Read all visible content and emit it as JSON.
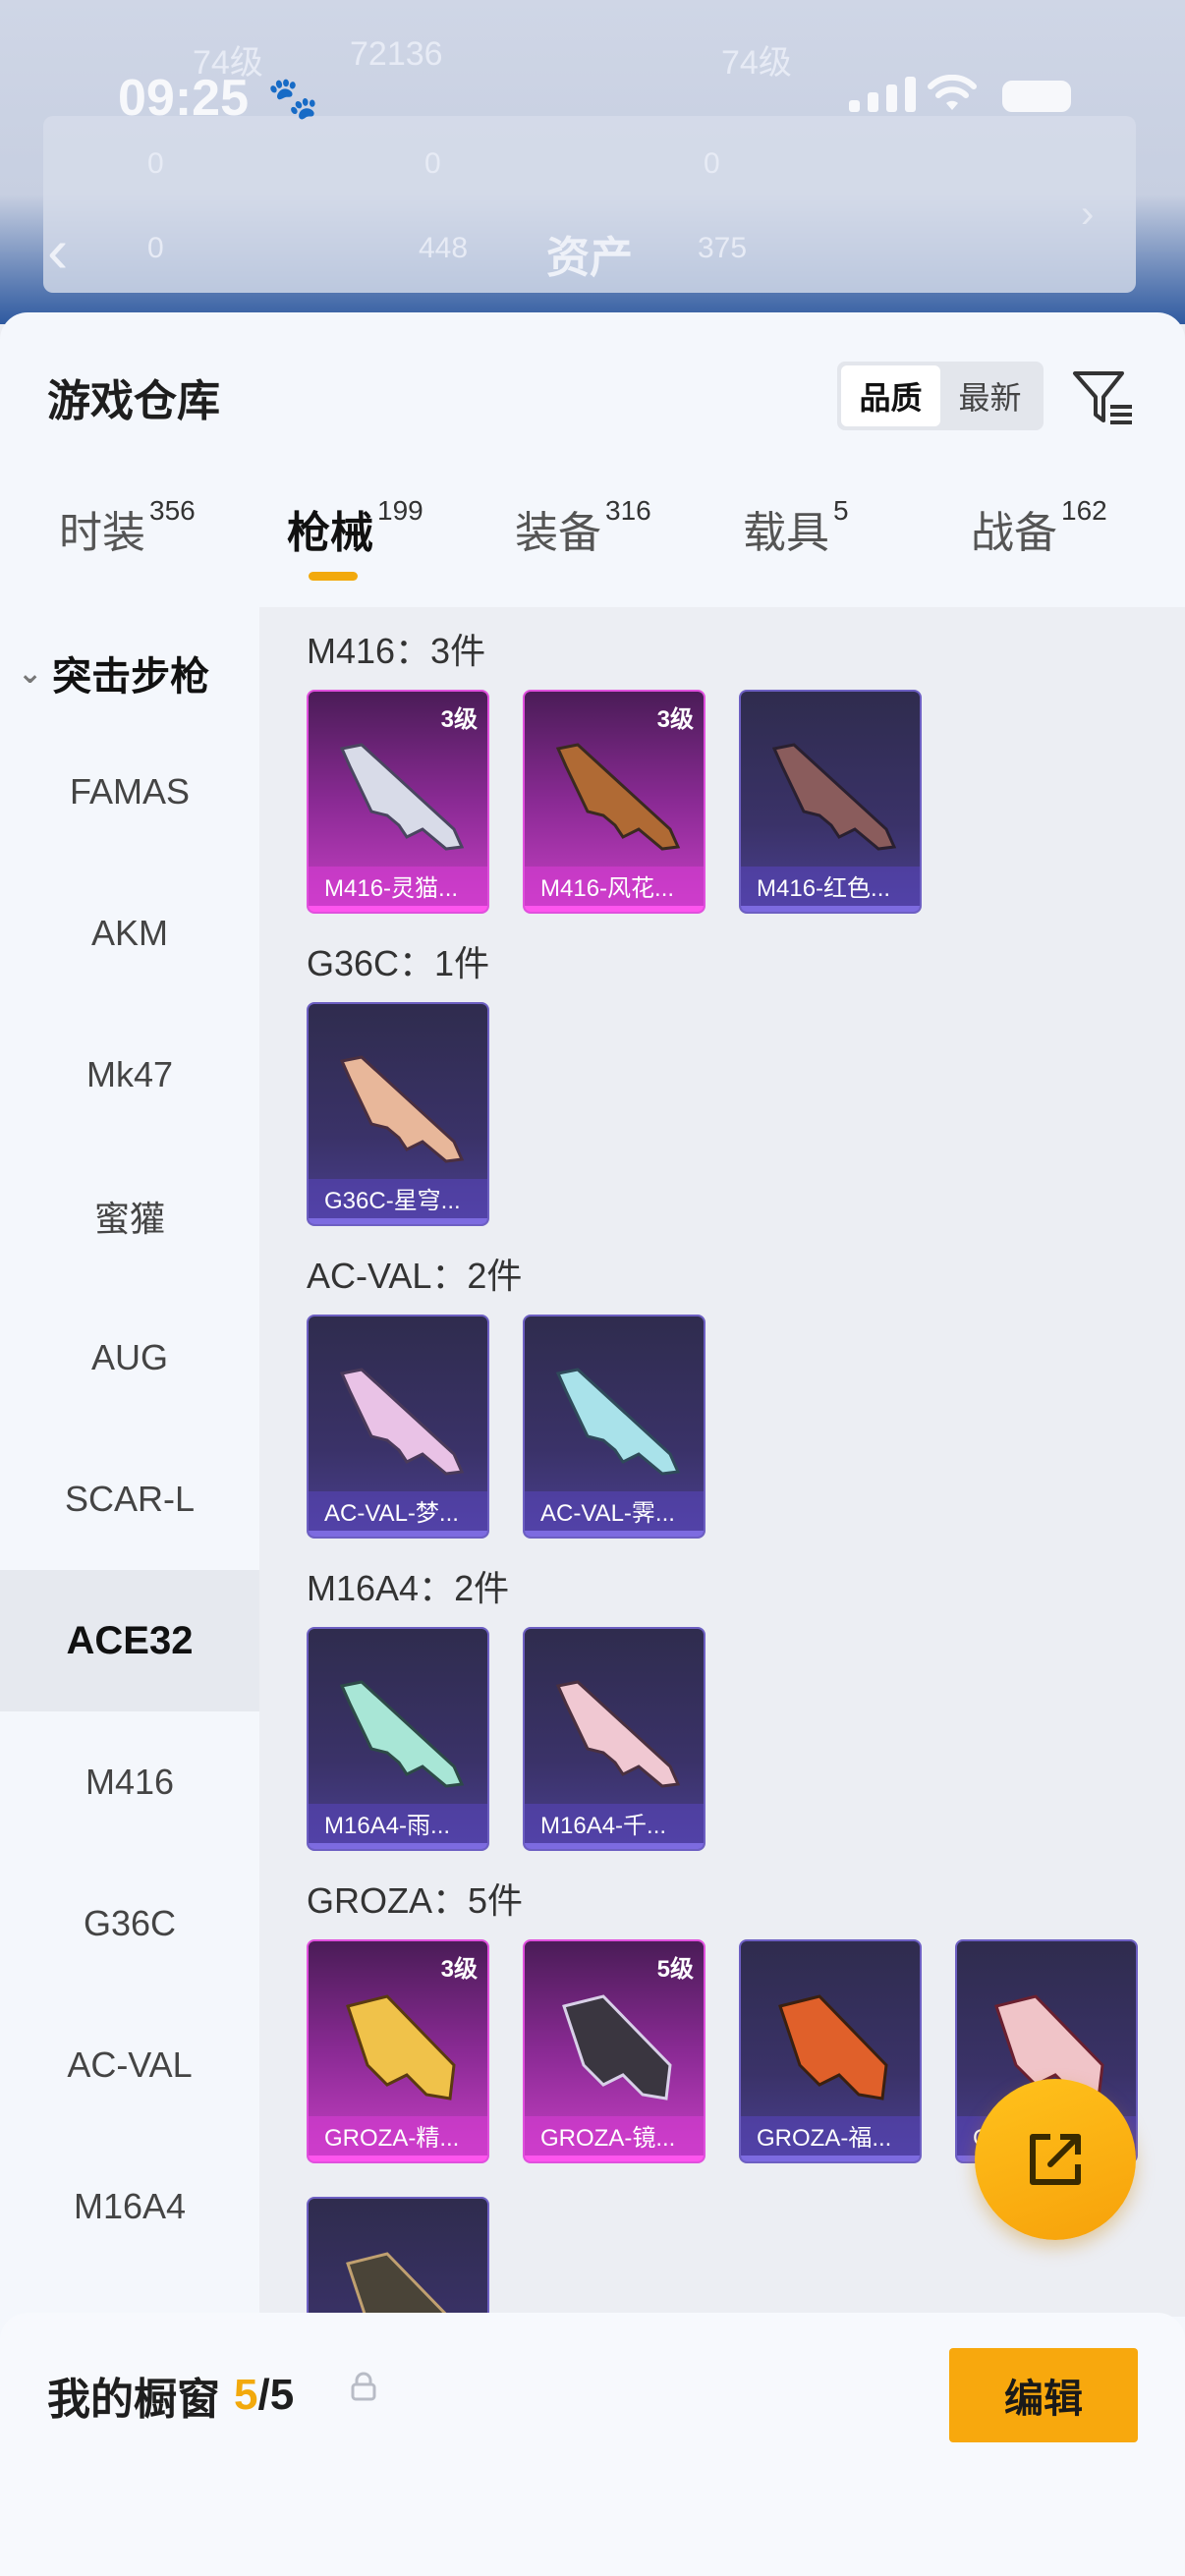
{
  "status": {
    "time": "09:25"
  },
  "background": {
    "title": "资产",
    "levels": [
      "74级",
      "74级"
    ],
    "numbers": [
      "72136",
      "0",
      "0",
      "0",
      "0",
      "448",
      "375"
    ]
  },
  "sheet": {
    "title": "游戏仓库",
    "sort": {
      "options": [
        "品质",
        "最新"
      ],
      "selected": "品质"
    },
    "tabs": [
      {
        "label": "时装",
        "count": "356"
      },
      {
        "label": "枪械",
        "count": "199",
        "active": true
      },
      {
        "label": "装备",
        "count": "316"
      },
      {
        "label": "载具",
        "count": "5"
      },
      {
        "label": "战备",
        "count": "162"
      }
    ],
    "sidebar": {
      "category": "突击步枪",
      "items": [
        "FAMAS",
        "AKM",
        "Mk47",
        "蜜獾",
        "AUG",
        "SCAR-L",
        "ACE32",
        "M416",
        "G36C",
        "AC-VAL",
        "M16A4"
      ],
      "selected": "ACE32"
    },
    "groups": [
      {
        "title": "M416：3件",
        "items": [
          {
            "name": "M416-灵猫...",
            "level": "3级",
            "quality": "pink"
          },
          {
            "name": "M416-风花...",
            "level": "3级",
            "quality": "pink"
          },
          {
            "name": "M416-红色...",
            "level": "",
            "quality": "purple"
          }
        ]
      },
      {
        "title": "G36C：1件",
        "items": [
          {
            "name": "G36C-星穹...",
            "level": "",
            "quality": "purple"
          }
        ]
      },
      {
        "title": "AC-VAL：2件",
        "items": [
          {
            "name": "AC-VAL-梦...",
            "level": "",
            "quality": "purple"
          },
          {
            "name": "AC-VAL-霁...",
            "level": "",
            "quality": "purple"
          }
        ]
      },
      {
        "title": "M16A4：2件",
        "items": [
          {
            "name": "M16A4-雨...",
            "level": "",
            "quality": "purple"
          },
          {
            "name": "M16A4-千...",
            "level": "",
            "quality": "purple"
          }
        ]
      },
      {
        "title": "GROZA：5件",
        "items": [
          {
            "name": "GROZA-精...",
            "level": "3级",
            "quality": "pink"
          },
          {
            "name": "GROZA-镜...",
            "level": "5级",
            "quality": "pink"
          },
          {
            "name": "GROZA-福...",
            "level": "",
            "quality": "purple"
          },
          {
            "name": "G",
            "level": "",
            "quality": "purple"
          },
          {
            "name": "",
            "level": "",
            "quality": "purple"
          }
        ]
      }
    ]
  },
  "showcase": {
    "label": "我的橱窗",
    "current": "5",
    "sep": "/",
    "total": "5",
    "edit_label": "编辑"
  },
  "colors": {
    "accent": "#f8a80d",
    "pink_quality": "#c640c4",
    "purple_quality": "#4a3f8f"
  },
  "icons": {
    "filter": "filter-icon",
    "share": "share-icon",
    "lock": "lock-icon",
    "back": "back-arrow-icon"
  }
}
